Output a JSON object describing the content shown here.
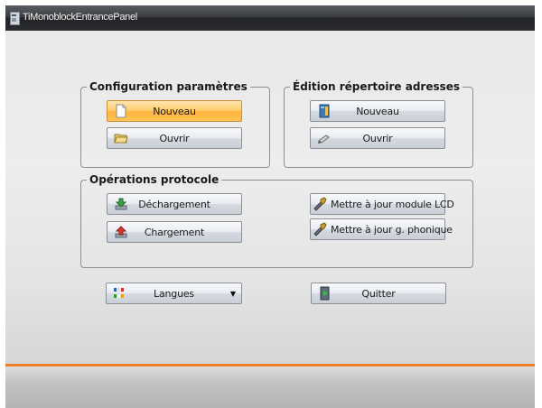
{
  "window": {
    "title": "TiMonoblockEntrancePanel"
  },
  "groups": {
    "config": {
      "title": "Configuration paramètres",
      "new_label": "Nouveau",
      "open_label": "Ouvrir"
    },
    "directory": {
      "title": "Édition répertoire adresses",
      "new_label": "Nouveau",
      "open_label": "Ouvrir"
    },
    "protocol": {
      "title": "Opérations protocole",
      "download_label": "Déchargement",
      "upload_label": "Chargement",
      "update_lcd_label": "Mettre à jour module LCD",
      "update_phonic_label": "Mettre à jour g. phonique"
    }
  },
  "bottom": {
    "languages_label": "Langues",
    "quit_label": "Quitter"
  },
  "colors": {
    "accent": "#ef7f2c",
    "active_button": "#ffc55a",
    "titlebar": "#2b2c2f"
  },
  "icons": [
    "app-icon",
    "new-document-icon",
    "open-folder-icon",
    "address-book-icon",
    "edit-pencil-icon",
    "download-tray-icon",
    "upload-tray-icon",
    "update-module-icon",
    "update-phonic-icon",
    "languages-icon",
    "exit-door-icon"
  ]
}
